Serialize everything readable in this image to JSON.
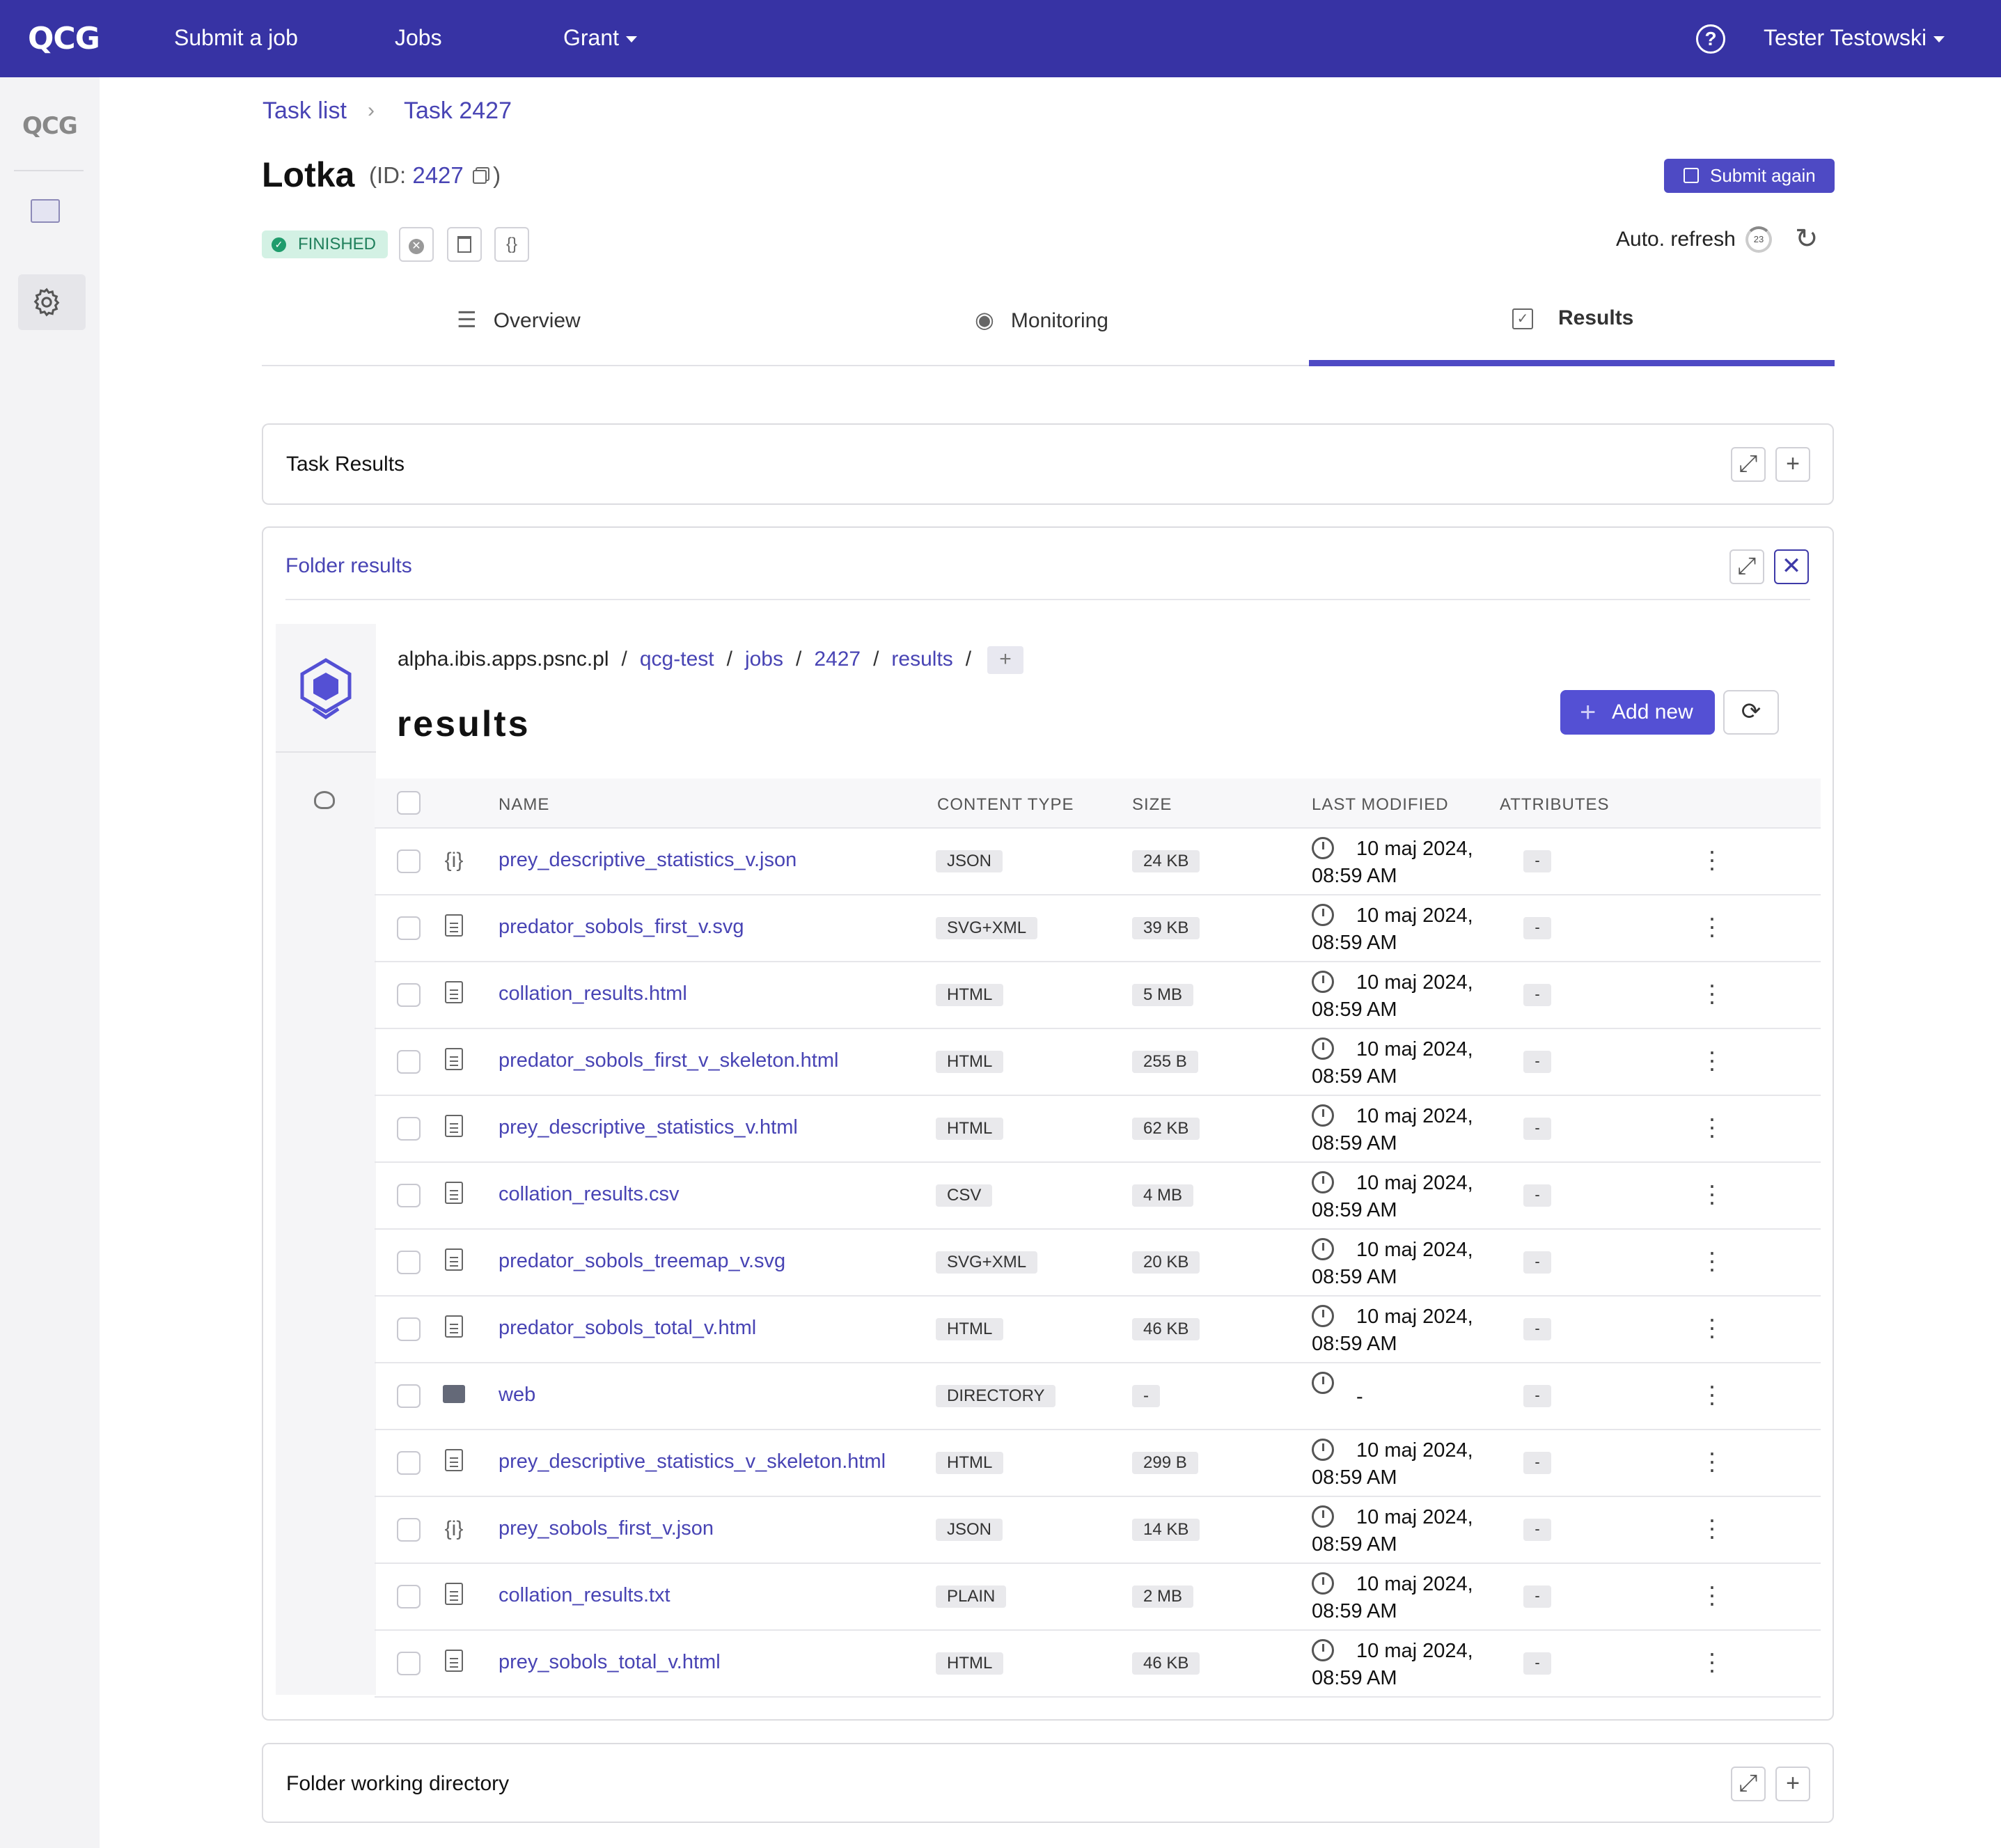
{
  "topbar": {
    "logo": "QCG",
    "nav": [
      "Submit a job",
      "Jobs",
      "Grant"
    ],
    "help_icon": "question-circle-icon",
    "user": "Tester Testowski"
  },
  "sidebar": {
    "logo": "QCG",
    "items": [
      {
        "icon": "folder-icon"
      },
      {
        "icon": "gear-icon"
      }
    ]
  },
  "breadcrumb": {
    "items": [
      "Task list",
      "Task 2427"
    ]
  },
  "task": {
    "name": "Lotka",
    "id_label": "(ID:",
    "id": "2427",
    "id_close": ")",
    "status": "FINISHED",
    "submit_again": "Submit again",
    "auto_refresh": "Auto. refresh",
    "auto_refresh_count": "23"
  },
  "tabs": [
    {
      "label": "Overview",
      "icon": "list-icon"
    },
    {
      "label": "Monitoring",
      "icon": "eye-icon"
    },
    {
      "label": "Results",
      "icon": "checkbox-icon",
      "active": true
    }
  ],
  "cards": {
    "task_results": "Task Results",
    "folder_results": "Folder results",
    "folder_working": "Folder working directory"
  },
  "browser": {
    "path": [
      "alpha.ibis.apps.psnc.pl",
      "qcg-test",
      "jobs",
      "2427",
      "results"
    ],
    "title": "results",
    "add_new": "Add new",
    "columns": [
      "NAME",
      "CONTENT TYPE",
      "SIZE",
      "LAST MODIFIED",
      "ATTRIBUTES"
    ],
    "rows": [
      {
        "name": "prey_descriptive_statistics_v.json",
        "type": "JSON",
        "size": "24 KB",
        "modified1": "10 maj 2024,",
        "modified2": "08:59 AM",
        "attr": "-",
        "icon": "json-icon"
      },
      {
        "name": "predator_sobols_first_v.svg",
        "type": "SVG+XML",
        "size": "39 KB",
        "modified1": "10 maj 2024,",
        "modified2": "08:59 AM",
        "attr": "-",
        "icon": "file-icon"
      },
      {
        "name": "collation_results.html",
        "type": "HTML",
        "size": "5 MB",
        "modified1": "10 maj 2024,",
        "modified2": "08:59 AM",
        "attr": "-",
        "icon": "file-icon"
      },
      {
        "name": "predator_sobols_first_v_skeleton.html",
        "type": "HTML",
        "size": "255 B",
        "modified1": "10 maj 2024,",
        "modified2": "08:59 AM",
        "attr": "-",
        "icon": "file-icon"
      },
      {
        "name": "prey_descriptive_statistics_v.html",
        "type": "HTML",
        "size": "62 KB",
        "modified1": "10 maj 2024,",
        "modified2": "08:59 AM",
        "attr": "-",
        "icon": "file-icon"
      },
      {
        "name": "collation_results.csv",
        "type": "CSV",
        "size": "4 MB",
        "modified1": "10 maj 2024,",
        "modified2": "08:59 AM",
        "attr": "-",
        "icon": "file-icon"
      },
      {
        "name": "predator_sobols_treemap_v.svg",
        "type": "SVG+XML",
        "size": "20 KB",
        "modified1": "10 maj 2024,",
        "modified2": "08:59 AM",
        "attr": "-",
        "icon": "file-icon"
      },
      {
        "name": "predator_sobols_total_v.html",
        "type": "HTML",
        "size": "46 KB",
        "modified1": "10 maj 2024,",
        "modified2": "08:59 AM",
        "attr": "-",
        "icon": "file-icon"
      },
      {
        "name": "web",
        "type": "DIRECTORY",
        "size": "-",
        "modified1": "-",
        "modified2": "",
        "attr": "-",
        "icon": "folder-icon"
      },
      {
        "name": "prey_descriptive_statistics_v_skeleton.html",
        "type": "HTML",
        "size": "299 B",
        "modified1": "10 maj 2024,",
        "modified2": "08:59 AM",
        "attr": "-",
        "icon": "file-icon"
      },
      {
        "name": "prey_sobols_first_v.json",
        "type": "JSON",
        "size": "14 KB",
        "modified1": "10 maj 2024,",
        "modified2": "08:59 AM",
        "attr": "-",
        "icon": "json-icon"
      },
      {
        "name": "collation_results.txt",
        "type": "PLAIN",
        "size": "2 MB",
        "modified1": "10 maj 2024,",
        "modified2": "08:59 AM",
        "attr": "-",
        "icon": "file-icon"
      },
      {
        "name": "prey_sobols_total_v.html",
        "type": "HTML",
        "size": "46 KB",
        "modified1": "10 maj 2024,",
        "modified2": "08:59 AM",
        "attr": "-",
        "icon": "file-icon"
      }
    ]
  },
  "colors": {
    "brand": "#3733a4",
    "accent": "#4e4ac4",
    "success": "#1f9c6c"
  }
}
